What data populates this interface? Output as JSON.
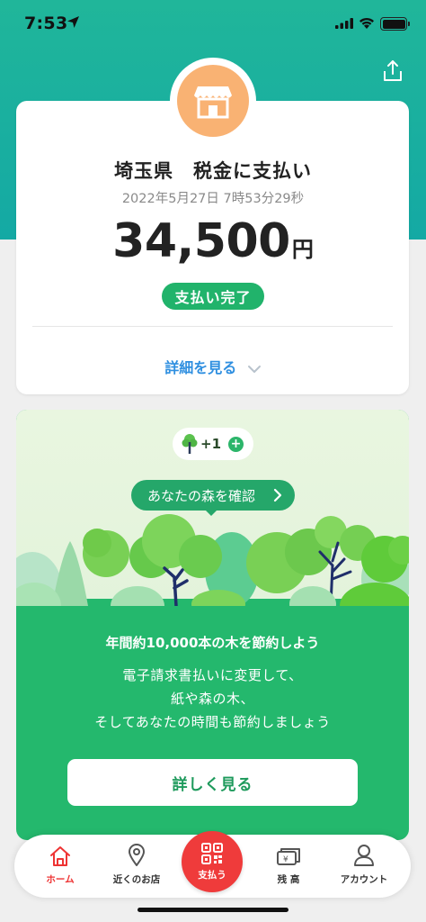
{
  "status_bar": {
    "time": "7:53"
  },
  "receipt": {
    "merchant": "埼玉県　税金に支払い",
    "timestamp": "2022年5月27日 7時53分29秒",
    "amount": "34,500",
    "currency": "円",
    "status": "支払い完了",
    "details_link": "詳細を見る"
  },
  "forest": {
    "tree_count": "+1",
    "forest_link": "あなたの森を確認",
    "save_title": "年間約10,000本の木を節約しよう",
    "save_body_line1": "電子請求書払いに変更して、",
    "save_body_line2": "紙や森の木、",
    "save_body_line3": "そしてあなたの時間も節約しましょう",
    "more_button": "詳しく見る"
  },
  "tab_bar": {
    "home": "ホーム",
    "nearby": "近くのお店",
    "pay": "支払う",
    "balance": "残 高",
    "account": "アカウント"
  },
  "colors": {
    "brand_teal": "#1ab39e",
    "pay_red": "#ef3b3b",
    "success_green": "#21b36b",
    "link_blue": "#2f8fe0",
    "shop_orange": "#f9b273"
  }
}
